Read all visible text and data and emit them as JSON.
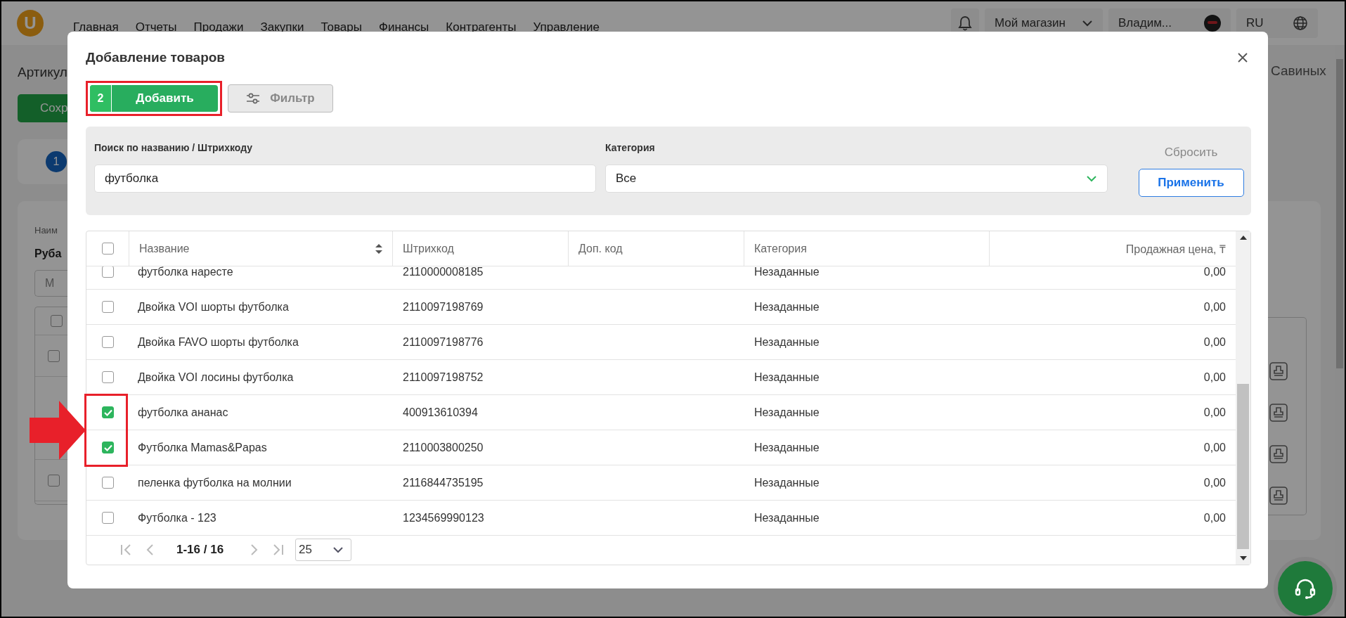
{
  "nav": {
    "logo_letter": "U",
    "items": [
      "Главная",
      "Отчеты",
      "Продажи",
      "Закупки",
      "Товары",
      "Финансы",
      "Контрагенты",
      "Управление"
    ],
    "shop": "Мой магазин",
    "user": "Владим...",
    "lang": "RU"
  },
  "page": {
    "title": "Артикул",
    "save_button": "Сохр",
    "step": "1",
    "field_label": "Наим",
    "field_value": "Руба",
    "input_text": "М",
    "author": "Савиных",
    "rows": [
      {
        "checked": false
      },
      {
        "checked": false
      },
      {
        "checked": false
      }
    ]
  },
  "dialog": {
    "title": "Добавление товаров",
    "add_button": {
      "count": "2",
      "label": "Добавить"
    },
    "filter_button": "Фильтр",
    "search": {
      "label": "Поиск по названию / Штрихкоду",
      "value": "футболка"
    },
    "category": {
      "label": "Категория",
      "value": "Все"
    },
    "reset": "Сбросить",
    "apply": "Применить",
    "table": {
      "select_all": {
        "checked": false
      },
      "columns": [
        "Название",
        "Штрихкод",
        "Доп. код",
        "Категория",
        "Продажная цена, ₸"
      ],
      "rows": [
        {
          "checked": false,
          "name": "футболка наресте",
          "barcode": "2110000008185",
          "category": "Незаданные",
          "price": "0,00"
        },
        {
          "checked": false,
          "name": "Двойка VOI шорты футболка",
          "barcode": "2110097198769",
          "category": "Незаданные",
          "price": "0,00"
        },
        {
          "checked": false,
          "name": "Двойка FAVO шорты футболка",
          "barcode": "2110097198776",
          "category": "Незаданные",
          "price": "0,00"
        },
        {
          "checked": false,
          "name": "Двойка VOI лосины футболка",
          "barcode": "2110097198752",
          "category": "Незаданные",
          "price": "0,00"
        },
        {
          "checked": true,
          "name": "футболка ананас",
          "barcode": "400913610394",
          "category": "Незаданные",
          "price": "0,00"
        },
        {
          "checked": true,
          "name": "Футболка Mamas&Papas",
          "barcode": "2110003800250",
          "category": "Незаданные",
          "price": "0,00"
        },
        {
          "checked": false,
          "name": "пеленка футболка на молнии",
          "barcode": "2116844735195",
          "category": "Незаданные",
          "price": "0,00"
        },
        {
          "checked": false,
          "name": "Футболка - 123",
          "barcode": "1234569990123",
          "category": "Незаданные",
          "price": "0,00"
        }
      ]
    },
    "pagination": {
      "range": "1-16 / 16",
      "page_size": "25"
    }
  }
}
